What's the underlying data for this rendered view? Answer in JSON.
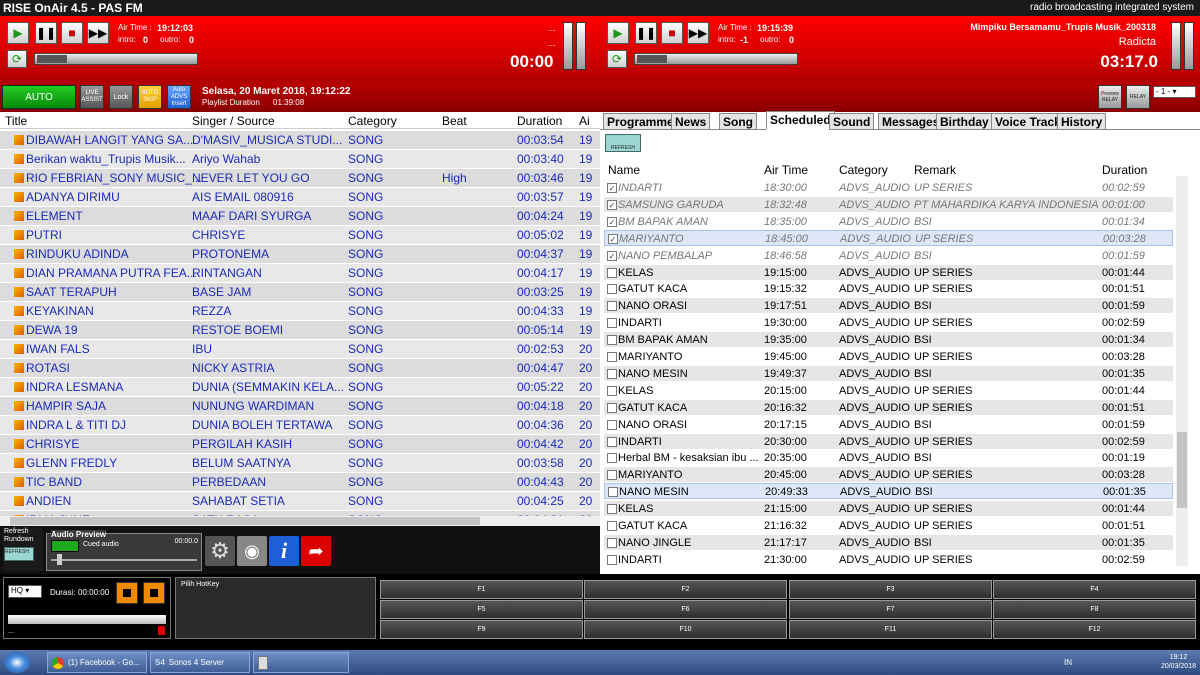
{
  "app": {
    "title": "RISE OnAir 4.5 - PAS FM",
    "subtitle": "radio broadcasting integrated system"
  },
  "player1": {
    "air_time_label": "Air Time :",
    "air_time": "19:12:03",
    "intro_label": "intro:",
    "intro": "0",
    "outro_label": "outro:",
    "outro": "0",
    "dots1": "...",
    "dots2": "...",
    "counter": "00:00"
  },
  "player2": {
    "air_time_label": "Air Time :",
    "air_time": "19:15:39",
    "intro_label": "intro:",
    "intro": "-1",
    "outro_label": "outro:",
    "outro": "0",
    "song": "Mimpiku Bersamamu_Trupis Musik_200318",
    "artist": "Radicta",
    "counter": "03:17.0"
  },
  "controls": {
    "auto": "AUTO",
    "live_assist": "LIVE ASSIST",
    "lock": "Lock",
    "auto_skip": "AUTO SKIP",
    "auto_advs": "Auto ADVS Insert",
    "date": "Selasa, 20 Maret 2018, 19:12:22",
    "playlist_duration_label": "Playlist Duration",
    "playlist_duration": "01:39:08",
    "preview_relay": "Preview RELAY",
    "relay": "RELAY",
    "relay_select": "- 1 -"
  },
  "playlist": {
    "headers": [
      "Title",
      "Singer / Source",
      "Category",
      "Beat",
      "Duration",
      "Ai"
    ],
    "rows": [
      [
        "DIBAWAH LANGIT YANG SA...",
        "D'MASIV_MUSICA STUDI...",
        "SONG",
        "",
        "00:03:54",
        "19"
      ],
      [
        "Berikan waktu_Trupis Musik...",
        "Ariyo Wahab",
        "SONG",
        "",
        "00:03:40",
        "19"
      ],
      [
        "RIO FEBRIAN_SONY MUSIC_...",
        "NEVER LET YOU GO",
        "SONG",
        "High",
        "00:03:46",
        "19"
      ],
      [
        "ADANYA DIRIMU",
        "AIS EMAIL 080916",
        "SONG",
        "",
        "00:03:57",
        "19"
      ],
      [
        "ELEMENT",
        "MAAF DARI SYURGA",
        "SONG",
        "",
        "00:04:24",
        "19"
      ],
      [
        "PUTRI",
        "CHRISYE",
        "SONG",
        "",
        "00:05:02",
        "19"
      ],
      [
        "RINDUKU ADINDA",
        "PROTONEMA",
        "SONG",
        "",
        "00:04:37",
        "19"
      ],
      [
        "DIAN PRAMANA PUTRA FEA...",
        "RINTANGAN",
        "SONG",
        "",
        "00:04:17",
        "19"
      ],
      [
        "SAAT TERAPUH",
        "BASE JAM",
        "SONG",
        "",
        "00:03:25",
        "19"
      ],
      [
        "KEYAKINAN",
        "REZZA",
        "SONG",
        "",
        "00:04:33",
        "19"
      ],
      [
        "DEWA 19",
        "RESTOE BOEMI",
        "SONG",
        "",
        "00:05:14",
        "19"
      ],
      [
        "IWAN FALS",
        "IBU",
        "SONG",
        "",
        "00:02:53",
        "20"
      ],
      [
        "ROTASI",
        "NICKY ASTRIA",
        "SONG",
        "",
        "00:04:47",
        "20"
      ],
      [
        "INDRA LESMANA",
        "DUNIA (SEMMAKIN KELA...",
        "SONG",
        "",
        "00:05:22",
        "20"
      ],
      [
        "HAMPIR SAJA",
        "NUNUNG WARDIMAN",
        "SONG",
        "",
        "00:04:18",
        "20"
      ],
      [
        "INDRA L & TITI DJ",
        "DUNIA BOLEH TERTAWA",
        "SONG",
        "",
        "00:04:36",
        "20"
      ],
      [
        "CHRISYE",
        "PERGILAH KASIH",
        "SONG",
        "",
        "00:04:42",
        "20"
      ],
      [
        "GLENN FREDLY",
        "BELUM SAATNYA",
        "SONG",
        "",
        "00:03:58",
        "20"
      ],
      [
        "TIC BAND",
        "PERBEDAAN",
        "SONG",
        "",
        "00:04:43",
        "20"
      ],
      [
        "ANDIEN",
        "SAHABAT SETIA",
        "SONG",
        "",
        "00:04:25",
        "20"
      ],
      [
        "IRMA JUNE",
        "SATU RASA",
        "SONG",
        "",
        "00:04:21",
        "20"
      ]
    ]
  },
  "tabs": [
    "Programme",
    "News",
    "Song",
    "Scheduled",
    "Sound",
    "Messages",
    "Birthday",
    "Voice Track",
    "History"
  ],
  "scheduled": {
    "refresh": "REFRESH",
    "headers": [
      "Name",
      "Air Time",
      "Category",
      "Remark",
      "Duration"
    ],
    "rows": [
      [
        "INDARTI",
        "18:30:00",
        "ADVS_AUDIO",
        "UP SERIES",
        "00:02:59"
      ],
      [
        "SAMSUNG GARUDA",
        "18:32:48",
        "ADVS_AUDIO",
        "PT MAHARDIKA KARYA INDONESIA",
        "00:01:00"
      ],
      [
        "BM BAPAK AMAN",
        "18:35:00",
        "ADVS_AUDIO",
        "BSI",
        "00:01:34"
      ],
      [
        "MARIYANTO",
        "18:45:00",
        "ADVS_AUDIO",
        "UP SERIES",
        "00:03:28"
      ],
      [
        "NANO PEMBALAP",
        "18:46:58",
        "ADVS_AUDIO",
        "BSI",
        "00:01:59"
      ],
      [
        "KELAS",
        "19:15:00",
        "ADVS_AUDIO",
        "UP SERIES",
        "00:01:44"
      ],
      [
        "GATUT KACA",
        "19:15:32",
        "ADVS_AUDIO",
        "UP SERIES",
        "00:01:51"
      ],
      [
        "NANO ORASI",
        "19:17:51",
        "ADVS_AUDIO",
        "BSI",
        "00:01:59"
      ],
      [
        "INDARTI",
        "19:30:00",
        "ADVS_AUDIO",
        "UP SERIES",
        "00:02:59"
      ],
      [
        "BM BAPAK AMAN",
        "19:35:00",
        "ADVS_AUDIO",
        "BSI",
        "00:01:34"
      ],
      [
        "MARIYANTO",
        "19:45:00",
        "ADVS_AUDIO",
        "UP SERIES",
        "00:03:28"
      ],
      [
        "NANO MESIN",
        "19:49:37",
        "ADVS_AUDIO",
        "BSI",
        "00:01:35"
      ],
      [
        "KELAS",
        "20:15:00",
        "ADVS_AUDIO",
        "UP SERIES",
        "00:01:44"
      ],
      [
        "GATUT KACA",
        "20:16:32",
        "ADVS_AUDIO",
        "UP SERIES",
        "00:01:51"
      ],
      [
        "NANO ORASI",
        "20:17:15",
        "ADVS_AUDIO",
        "BSI",
        "00:01:59"
      ],
      [
        "INDARTI",
        "20:30:00",
        "ADVS_AUDIO",
        "UP SERIES",
        "00:02:59"
      ],
      [
        "Herbal BM - kesaksian ibu ...",
        "20:35:00",
        "ADVS_AUDIO",
        "BSI",
        "00:01:19"
      ],
      [
        "MARIYANTO",
        "20:45:00",
        "ADVS_AUDIO",
        "UP SERIES",
        "00:03:28"
      ],
      [
        "NANO MESIN",
        "20:49:33",
        "ADVS_AUDIO",
        "BSI",
        "00:01:35"
      ],
      [
        "KELAS",
        "21:15:00",
        "ADVS_AUDIO",
        "UP SERIES",
        "00:01:44"
      ],
      [
        "GATUT KACA",
        "21:16:32",
        "ADVS_AUDIO",
        "UP SERIES",
        "00:01:51"
      ],
      [
        "NANO JINGLE",
        "21:17:17",
        "ADVS_AUDIO",
        "BSI",
        "00:01:35"
      ],
      [
        "INDARTI",
        "21:30:00",
        "ADVS_AUDIO",
        "UP SERIES",
        "00:02:59"
      ]
    ]
  },
  "bottom": {
    "refresh_rundown": "Refresh Rundown",
    "rundown_icon": "REFRESH",
    "audio_preview": "Audio Preview",
    "cued": "Cued audio",
    "cued_time": "00:00.0"
  },
  "hotkey": {
    "quality": "HQ",
    "durasi_label": "Durasi:",
    "durasi": "00:00:00",
    "dots": "...",
    "pilih": "Pilih HotKey",
    "keys": [
      "F1",
      "F2",
      "F3",
      "F4",
      "F5",
      "F6",
      "F7",
      "F8",
      "F9",
      "F10",
      "F11",
      "F12"
    ],
    "cue_in": "CUE IN",
    "cue_out": "CUE OUT"
  },
  "taskbar": {
    "items": [
      "(1) Facebook - Go...",
      "Sonos 4 Server"
    ],
    "lang": "IN",
    "time": "19:12",
    "date": "20/03/2018"
  },
  "colors": {
    "accent_red": "#e00000",
    "playlist_text": "#1a2ab8",
    "play_green": "#1a9a1a"
  }
}
